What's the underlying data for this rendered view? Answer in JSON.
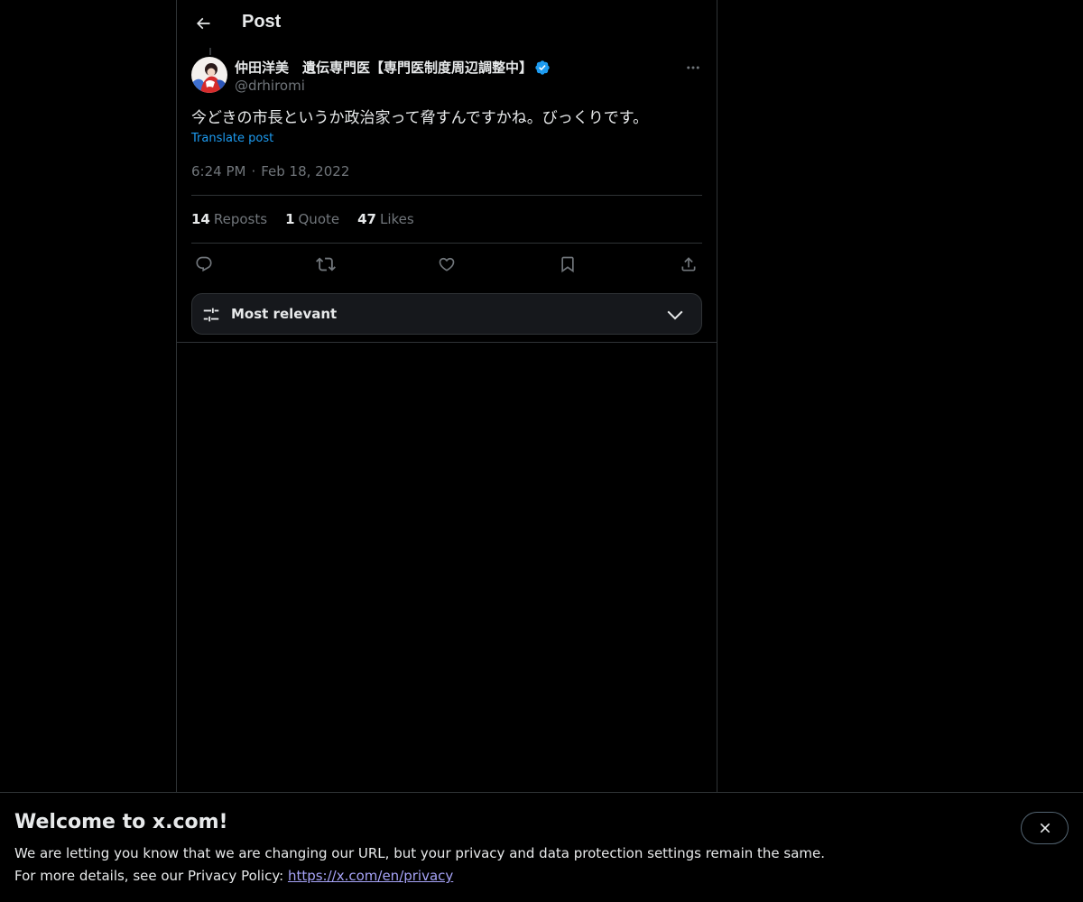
{
  "header": {
    "title": "Post",
    "back_icon": "arrow-left-icon"
  },
  "post": {
    "author_name": "仲田洋美　遺伝専門医【専門医制度周辺調整中】",
    "author_handle": "@drhiromi",
    "verified": true,
    "text": "今どきの市長というか政治家って脅すんですかね。びっくりです。",
    "translate_label": "Translate post",
    "time": "6:24 PM",
    "separator": "·",
    "date": "Feb 18, 2022",
    "stats": {
      "reposts_count": "14",
      "reposts_label": "Reposts",
      "quotes_count": "1",
      "quotes_label": "Quote",
      "likes_count": "47",
      "likes_label": "Likes"
    },
    "actions": [
      "reply-icon",
      "repost-icon",
      "like-icon",
      "bookmark-icon",
      "share-icon"
    ]
  },
  "replies_sort": {
    "label": "Most relevant"
  },
  "banner": {
    "title": "Welcome to x.com!",
    "line1": "We are letting you know that we are changing our URL, but your privacy and data protection settings remain the same.",
    "line2_prefix": "For more details, see our Privacy Policy: ",
    "privacy_link": "https://x.com/en/privacy"
  },
  "colors": {
    "background": "#000000",
    "text_primary": "#e7e9ea",
    "text_secondary": "#71767b",
    "accent": "#1d9bf0",
    "border": "#2f3336",
    "link_visited": "#a6a3f7"
  }
}
